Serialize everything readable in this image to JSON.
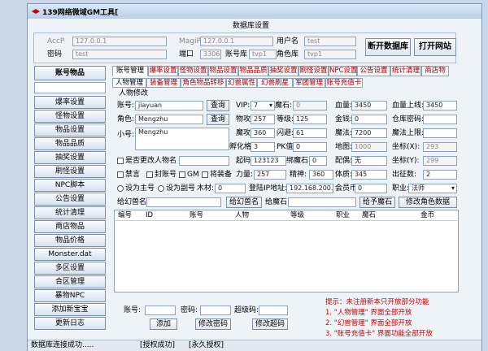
{
  "window": {
    "title": "139网络微域GM工具[",
    "db_settings_label": "数据库设置"
  },
  "db": {
    "acc_label": "AccP",
    "acc_ip": "127.0.0.1",
    "magip_label": "MagiP",
    "mag_ip": "127.0.0.1",
    "user_label": "用户名",
    "user_value": "test",
    "pwd_label": "密码",
    "pwd_value": "test",
    "port_label": "端口",
    "port_value": "3306",
    "account_db_label": "账号库",
    "account_db_value": "tvp1",
    "role_db_label": "角色库",
    "role_db_value": "tvp1",
    "disconnect_btn": "断开数据库",
    "open_site_btn": "打开网站"
  },
  "nav": {
    "account_items": "账号物品",
    "items": [
      "爆率设置",
      "怪物设置",
      "物品设置",
      "物品品质",
      "抽奖设置",
      "刷怪设置",
      "NPC脚本",
      "公告设置",
      "统计清理",
      "商店物品",
      "物品价格",
      "Monster.dat",
      "多区设置",
      "合区管理",
      "暴物NPC",
      "添加新宝宝",
      "更新日志"
    ]
  },
  "tabs": [
    "账号管理",
    "爆率设置",
    "怪物设置",
    "物品设置",
    "物品品质",
    "抽奖设置",
    "刷怪设置",
    "NPC设置",
    "公告设置",
    "统计清理",
    "商店物"
  ],
  "subtabs": [
    "人物管理",
    "装备管理",
    "角色物品转移",
    "幻兽属性",
    "幻兽刷星",
    "军团管理",
    "账号充值卡"
  ],
  "form": {
    "section_label": "人物修改",
    "account_label": "账号:",
    "account_value": "jiayuan",
    "role_label": "角色:",
    "role_value": "Mengzhu",
    "nickname_label": "小号:",
    "nickname_value": "Mengzhu",
    "query_btn": "查询",
    "vip_label": "VIP:",
    "vip_value": "7",
    "magic_stone_label": "魔石:",
    "magic_stone_value": "0",
    "hp_label": "血量:",
    "hp_value": "3450",
    "hp_max_label": "血量上线:",
    "hp_max_value": "3450",
    "phys_def_label": "物攻:",
    "phys_def_value": "257",
    "level_label": "等级:",
    "level_value": "125",
    "gold_label": "金钱:",
    "gold_value": "0",
    "warehouse_label": "仓库密码:",
    "magic_atk_label": "魔攻:",
    "magic_atk_value": "360",
    "dodge_label": "闪避:",
    "dodge_value": "61",
    "mana_label": "魔法:",
    "mana_value": "7200",
    "mana_max_label": "魔法上限:",
    "hatch_label": "孵化格:",
    "hatch_value": "3",
    "pk_label": "PK值:",
    "pk_value": "0",
    "map_label": "地图:",
    "map_value": "1000",
    "coord_x_label": "坐标(X):",
    "coord_x_value": "293",
    "rename_label": "是否更改人物名",
    "birth_label": "起码:",
    "birth_value": "123123",
    "bind_stone_label": "绑魔石:",
    "bind_stone_value": "0",
    "guild_label": "配偶:",
    "guild_value": "无",
    "coord_y_label": "坐标(Y):",
    "coord_y_value": "299",
    "ban_say_label": "禁言",
    "ban_acc_label": "封账号",
    "gm_label": "GM",
    "pet_label": "将装备",
    "str_label": "力量:",
    "str_value": "257",
    "spirit_label": "精神:",
    "spirit_value": "360",
    "con_label": "体质:",
    "con_value": "345",
    "stage_label": "出征数:",
    "stage_value": "2",
    "set_main_label": "设为主号",
    "set_sub_label": "设为副号",
    "wood_label": "木材:",
    "wood_value": "0",
    "login_ip_label": "登陆IP地址:",
    "login_ip_value": "192.168.200.1",
    "member_label": "会员币:",
    "member_value": "0",
    "job_label": "职业:",
    "job_value": "法师",
    "add_pet_label": "给幻兽名:",
    "give_pet_btn": "给幻兽名",
    "add_stone_label": "给魔石:",
    "give_stone_btn": "给予魔石",
    "edit_role_btn": "修改角色数据"
  },
  "table": {
    "headers": [
      "编号",
      "ID",
      "账号",
      "人物",
      "等级",
      "职业",
      "魔石",
      "金币"
    ]
  },
  "bottom": {
    "account_label": "账号:",
    "pwd_label": "密码:",
    "super_pwd_label": "超级码:",
    "add_btn": "添加",
    "edit_pwd_btn": "修改密码",
    "edit_super_btn": "修改超码",
    "notes": [
      "提示：未注册新本只开放部分功能",
      "1. \"人物管理\" 界面全部开放",
      "2. \"幻兽管理\" 界面全部开放",
      "3. \"账号充值卡\" 界面功能全部开放"
    ]
  },
  "status": {
    "left": "数据库连接成功.....",
    "auth": "[授权成功]",
    "perm": "[永久授权]"
  }
}
